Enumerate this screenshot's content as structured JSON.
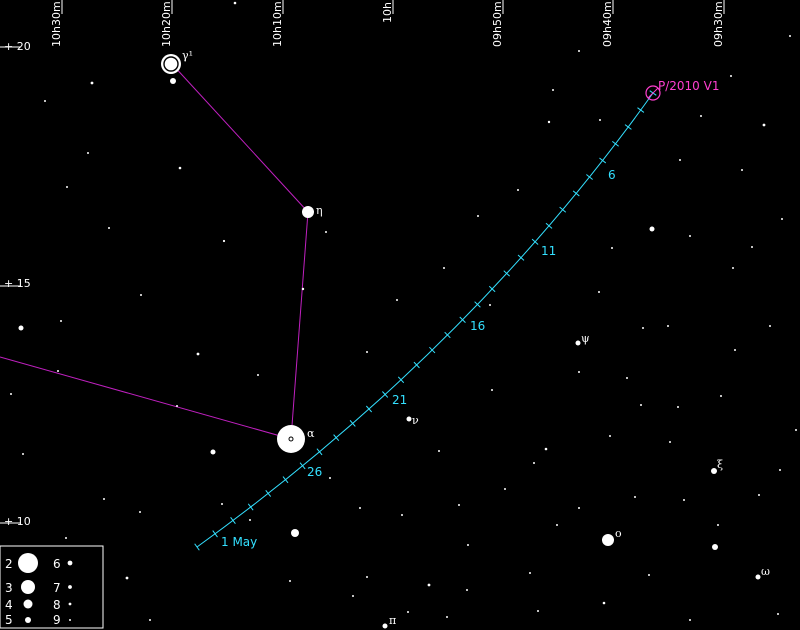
{
  "ra_labels": [
    "10h30m",
    "10h20m",
    "10h10m",
    "10h",
    "09h50m",
    "09h40m",
    "09h30m"
  ],
  "dec_labels": [
    "+ 20",
    "+ 15",
    "+ 10"
  ],
  "comet": {
    "name": "P/2010 V1",
    "color": "#ff3fd0"
  },
  "path": {
    "color": "#33e0ff",
    "date_labels": [
      "1 May",
      "26",
      "21",
      "16",
      "11",
      "6"
    ]
  },
  "constellation_line_color": "#c020c0",
  "stars": {
    "gamma1": "γ¹",
    "eta": "η",
    "alpha": "α",
    "nu": "ν",
    "psi": "ψ",
    "xi": "ξ",
    "o": "o",
    "omega": "ω",
    "pi": "π"
  },
  "legend": {
    "magnitudes": [
      "2",
      "3",
      "4",
      "5",
      "6",
      "7",
      "8",
      "9"
    ]
  }
}
